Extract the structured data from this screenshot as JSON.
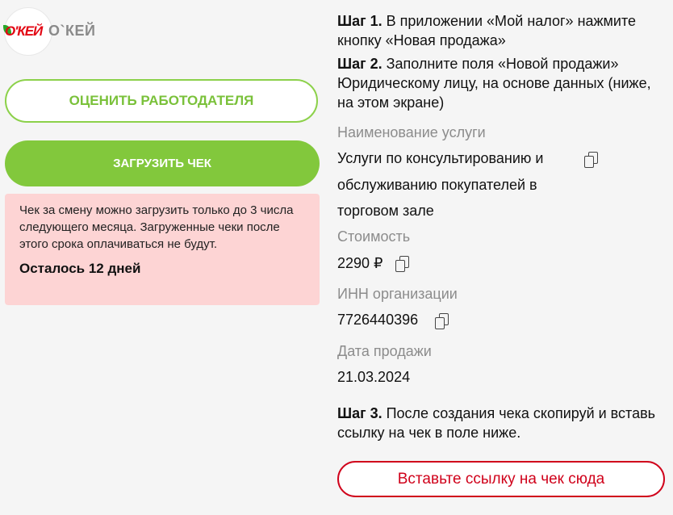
{
  "logo": {
    "mark": "О'КЕЙ",
    "name": "О`КЕЙ"
  },
  "buttons": {
    "rate_employer": "ОЦЕНИТЬ РАБОТОДАТЕЛЯ",
    "upload_receipt": "ЗАГРУЗИТЬ ЧЕК"
  },
  "warning": {
    "text": "Чек за смену можно загрузить только до 3 числа следующего месяца. Загруженные чеки после этого срока оплачиваться не будут.",
    "days_left": "Осталось 12 дней"
  },
  "steps": {
    "step1_label": "Шаг 1.",
    "step1_text": " В приложении «Мой налог» нажмите кнопку «Новая продажа»",
    "step2_label": "Шаг 2.",
    "step2_text": " Заполните поля «Новой продажи» Юридическому лицу, на основе данных (ниже, на этом экране)",
    "step3_label": "Шаг 3.",
    "step3_text": " После создания чека скопируй и вставь ссылку на чек в поле ниже."
  },
  "fields": {
    "service_label": "Наименование услуги",
    "service_line1": "Услуги по консультированию и",
    "service_line2": "обслуживанию покупателей в",
    "service_line3": "торговом зале",
    "cost_label": "Стоимость",
    "cost_value": "2290 ₽",
    "inn_label": "ИНН организации",
    "inn_value": "7726440396",
    "date_label": "Дата продажи",
    "date_value": "21.03.2024"
  },
  "link_input": {
    "placeholder": "Вставьте ссылку на чек сюда"
  },
  "icons": [
    "copy-icon"
  ],
  "colors": {
    "accent_green": "#82c83c",
    "warning_bg": "#fdd4d4",
    "accent_red": "#d0021b"
  }
}
